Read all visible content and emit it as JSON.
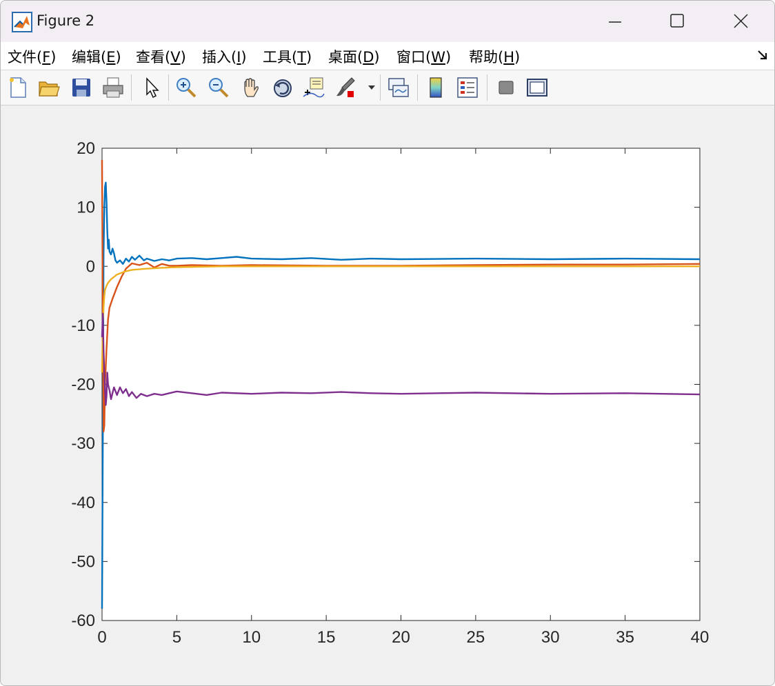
{
  "window": {
    "title": "Figure 2"
  },
  "menu": [
    {
      "text": "文件(",
      "key": "F",
      "end": ")"
    },
    {
      "text": "编辑(",
      "key": "E",
      "end": ")"
    },
    {
      "text": "查看(",
      "key": "V",
      "end": ")"
    },
    {
      "text": "插入(",
      "key": "I",
      "end": ")"
    },
    {
      "text": "工具(",
      "key": "T",
      "end": ")"
    },
    {
      "text": "桌面(",
      "key": "D",
      "end": ")"
    },
    {
      "text": "窗口(",
      "key": "W",
      "end": ")"
    },
    {
      "text": "帮助(",
      "key": "H",
      "end": ")"
    }
  ],
  "toolbar": [
    "new-figure-icon",
    "open-file-icon",
    "save-icon",
    "print-icon",
    "pointer-icon",
    "zoom-in-icon",
    "zoom-out-icon",
    "pan-icon",
    "rotate-3d-icon",
    "data-cursor-icon",
    "brush-icon",
    "link-plot-icon",
    "colorbar-icon",
    "legend-icon",
    "hide-plot-tools-icon",
    "show-plot-tools-icon"
  ],
  "chart_data": {
    "type": "line",
    "title": "",
    "xlabel": "",
    "ylabel": "",
    "xlim": [
      0,
      40
    ],
    "ylim": [
      -60,
      20
    ],
    "xticks": [
      0,
      5,
      10,
      15,
      20,
      25,
      30,
      35,
      40
    ],
    "yticks": [
      -60,
      -50,
      -40,
      -30,
      -20,
      -10,
      0,
      10,
      20
    ],
    "grid": false,
    "series": [
      {
        "color": "#0072bd",
        "x": [
          0,
          0.05,
          0.1,
          0.15,
          0.2,
          0.25,
          0.3,
          0.35,
          0.4,
          0.45,
          0.5,
          0.6,
          0.7,
          0.8,
          0.9,
          1.0,
          1.2,
          1.4,
          1.6,
          1.8,
          2.0,
          2.2,
          2.5,
          2.8,
          3.0,
          3.5,
          4.0,
          4.5,
          5.0,
          6,
          7,
          8,
          9,
          10,
          12,
          14,
          16,
          18,
          20,
          25,
          30,
          35,
          40
        ],
        "values": [
          -58,
          -30,
          2,
          10,
          13.5,
          14.2,
          11,
          6,
          3,
          4.5,
          2.5,
          2,
          3,
          2.2,
          1,
          0.6,
          1,
          0.4,
          1.3,
          0.8,
          1.6,
          1.1,
          1.8,
          1.0,
          1.3,
          0.9,
          1.2,
          1.0,
          1.3,
          1.4,
          1.2,
          1.4,
          1.6,
          1.3,
          1.2,
          1.4,
          1.1,
          1.3,
          1.2,
          1.3,
          1.2,
          1.3,
          1.2
        ]
      },
      {
        "color": "#d95319",
        "x": [
          0,
          0.05,
          0.1,
          0.15,
          0.2,
          0.3,
          0.4,
          0.5,
          0.7,
          1.0,
          1.3,
          1.6,
          2.0,
          2.5,
          3.0,
          3.5,
          4.0,
          4.5,
          5,
          6,
          8,
          10,
          15,
          20,
          25,
          30,
          35,
          40
        ],
        "values": [
          18,
          -10,
          -28,
          -27,
          -20,
          -14,
          -9,
          -7,
          -5.5,
          -3.5,
          -1.8,
          -0.4,
          0.5,
          0.2,
          0.6,
          -0.2,
          0.4,
          0.1,
          0.1,
          0.2,
          0.1,
          0.2,
          0.1,
          0.1,
          0.2,
          0.3,
          0.3,
          0.4
        ]
      },
      {
        "color": "#edb120",
        "x": [
          0,
          0.05,
          0.1,
          0.15,
          0.2,
          0.3,
          0.4,
          0.6,
          0.8,
          1.0,
          1.5,
          2.0,
          3,
          4,
          5,
          8,
          10,
          15,
          20,
          30,
          40
        ],
        "values": [
          -18,
          -10,
          -7,
          -5,
          -4,
          -3.3,
          -2.8,
          -2.2,
          -1.8,
          -1.4,
          -0.9,
          -0.6,
          -0.4,
          -0.25,
          -0.15,
          0,
          0,
          0,
          0,
          0,
          0
        ]
      },
      {
        "color": "#7e2f8e",
        "x": [
          0,
          0.05,
          0.1,
          0.15,
          0.2,
          0.25,
          0.3,
          0.35,
          0.4,
          0.5,
          0.6,
          0.8,
          1.0,
          1.2,
          1.4,
          1.6,
          1.8,
          2.0,
          2.3,
          2.6,
          3.0,
          3.5,
          4.0,
          4.5,
          5,
          6,
          7,
          8,
          10,
          12,
          14,
          16,
          18,
          20,
          25,
          30,
          35,
          40
        ],
        "values": [
          -12,
          -8,
          -14,
          -18,
          -21,
          -23.5,
          -22,
          -18,
          -20,
          -21,
          -22.5,
          -20.5,
          -21.8,
          -20.5,
          -21.5,
          -20.8,
          -22,
          -21.3,
          -22.3,
          -21.6,
          -22,
          -21.6,
          -21.8,
          -21.5,
          -21.2,
          -21.5,
          -21.8,
          -21.4,
          -21.6,
          -21.4,
          -21.5,
          -21.3,
          -21.5,
          -21.6,
          -21.4,
          -21.6,
          -21.5,
          -21.7
        ]
      }
    ]
  }
}
